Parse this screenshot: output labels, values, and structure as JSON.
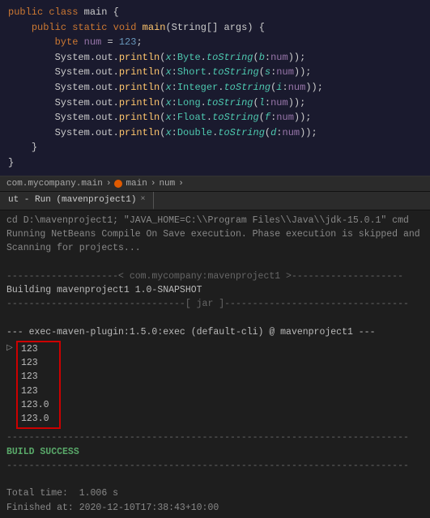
{
  "breadcrumb": {
    "package": "com.mycompany.main",
    "sep1": ">",
    "class": "main",
    "sep2": ">",
    "variable": "num",
    "sep3": ">"
  },
  "tab": {
    "label": "ut - Run (mavenproject1)",
    "close": "×"
  },
  "output": {
    "line1": "cd D:\\mavenproject1; \"JAVA_HOME=C:\\\\Program Files\\\\Java\\\\jdk-15.0.1\" cmd ",
    "line2": "Running NetBeans Compile On Save execution. Phase execution is skipped and",
    "line3": "Scanning for projects...",
    "line4": "",
    "sep1": "--------------------< com.mycompany:mavenproject1 >--------------------",
    "line5": "Building mavenproject1 1.0-SNAPSHOT",
    "sep2": "--------------------------------[ jar ]---------------------------------",
    "line6": "",
    "line7": "--- exec-maven-plugin:1.5.0:exec (default-cli) @ mavenproject1 ---",
    "values": [
      "123",
      "123",
      "123",
      "123",
      "123.0",
      "123.0"
    ],
    "sep3": "------------------------------------------------------------------------",
    "build_success": "BUILD SUCCESS",
    "sep4": "------------------------------------------------------------------------",
    "line8": "",
    "total_time": "Total time:  1.006 s",
    "finished_at": "Finished at: 2020-12-10T17:38:43+10:00"
  },
  "code": {
    "lines": [
      {
        "num": "",
        "text": "public class main {"
      },
      {
        "num": "",
        "text": "    public static void main(String[] args) {"
      },
      {
        "num": "",
        "text": "        byte num = 123;"
      },
      {
        "num": "",
        "text": "        System.out.println(x:Byte.toString(b:num));"
      },
      {
        "num": "",
        "text": "        System.out.println(x:Short.toString(s:num));"
      },
      {
        "num": "",
        "text": "        System.out.println(x:Integer.toString(i:num));"
      },
      {
        "num": "",
        "text": "        System.out.println(x:Long.toString(l:num));"
      },
      {
        "num": "",
        "text": "        System.out.println(x:Float.toString(f:num));"
      },
      {
        "num": "",
        "text": "        System.out.println(x:Double.toString(d:num));"
      },
      {
        "num": "",
        "text": "    }"
      },
      {
        "num": "",
        "text": "}"
      }
    ]
  }
}
